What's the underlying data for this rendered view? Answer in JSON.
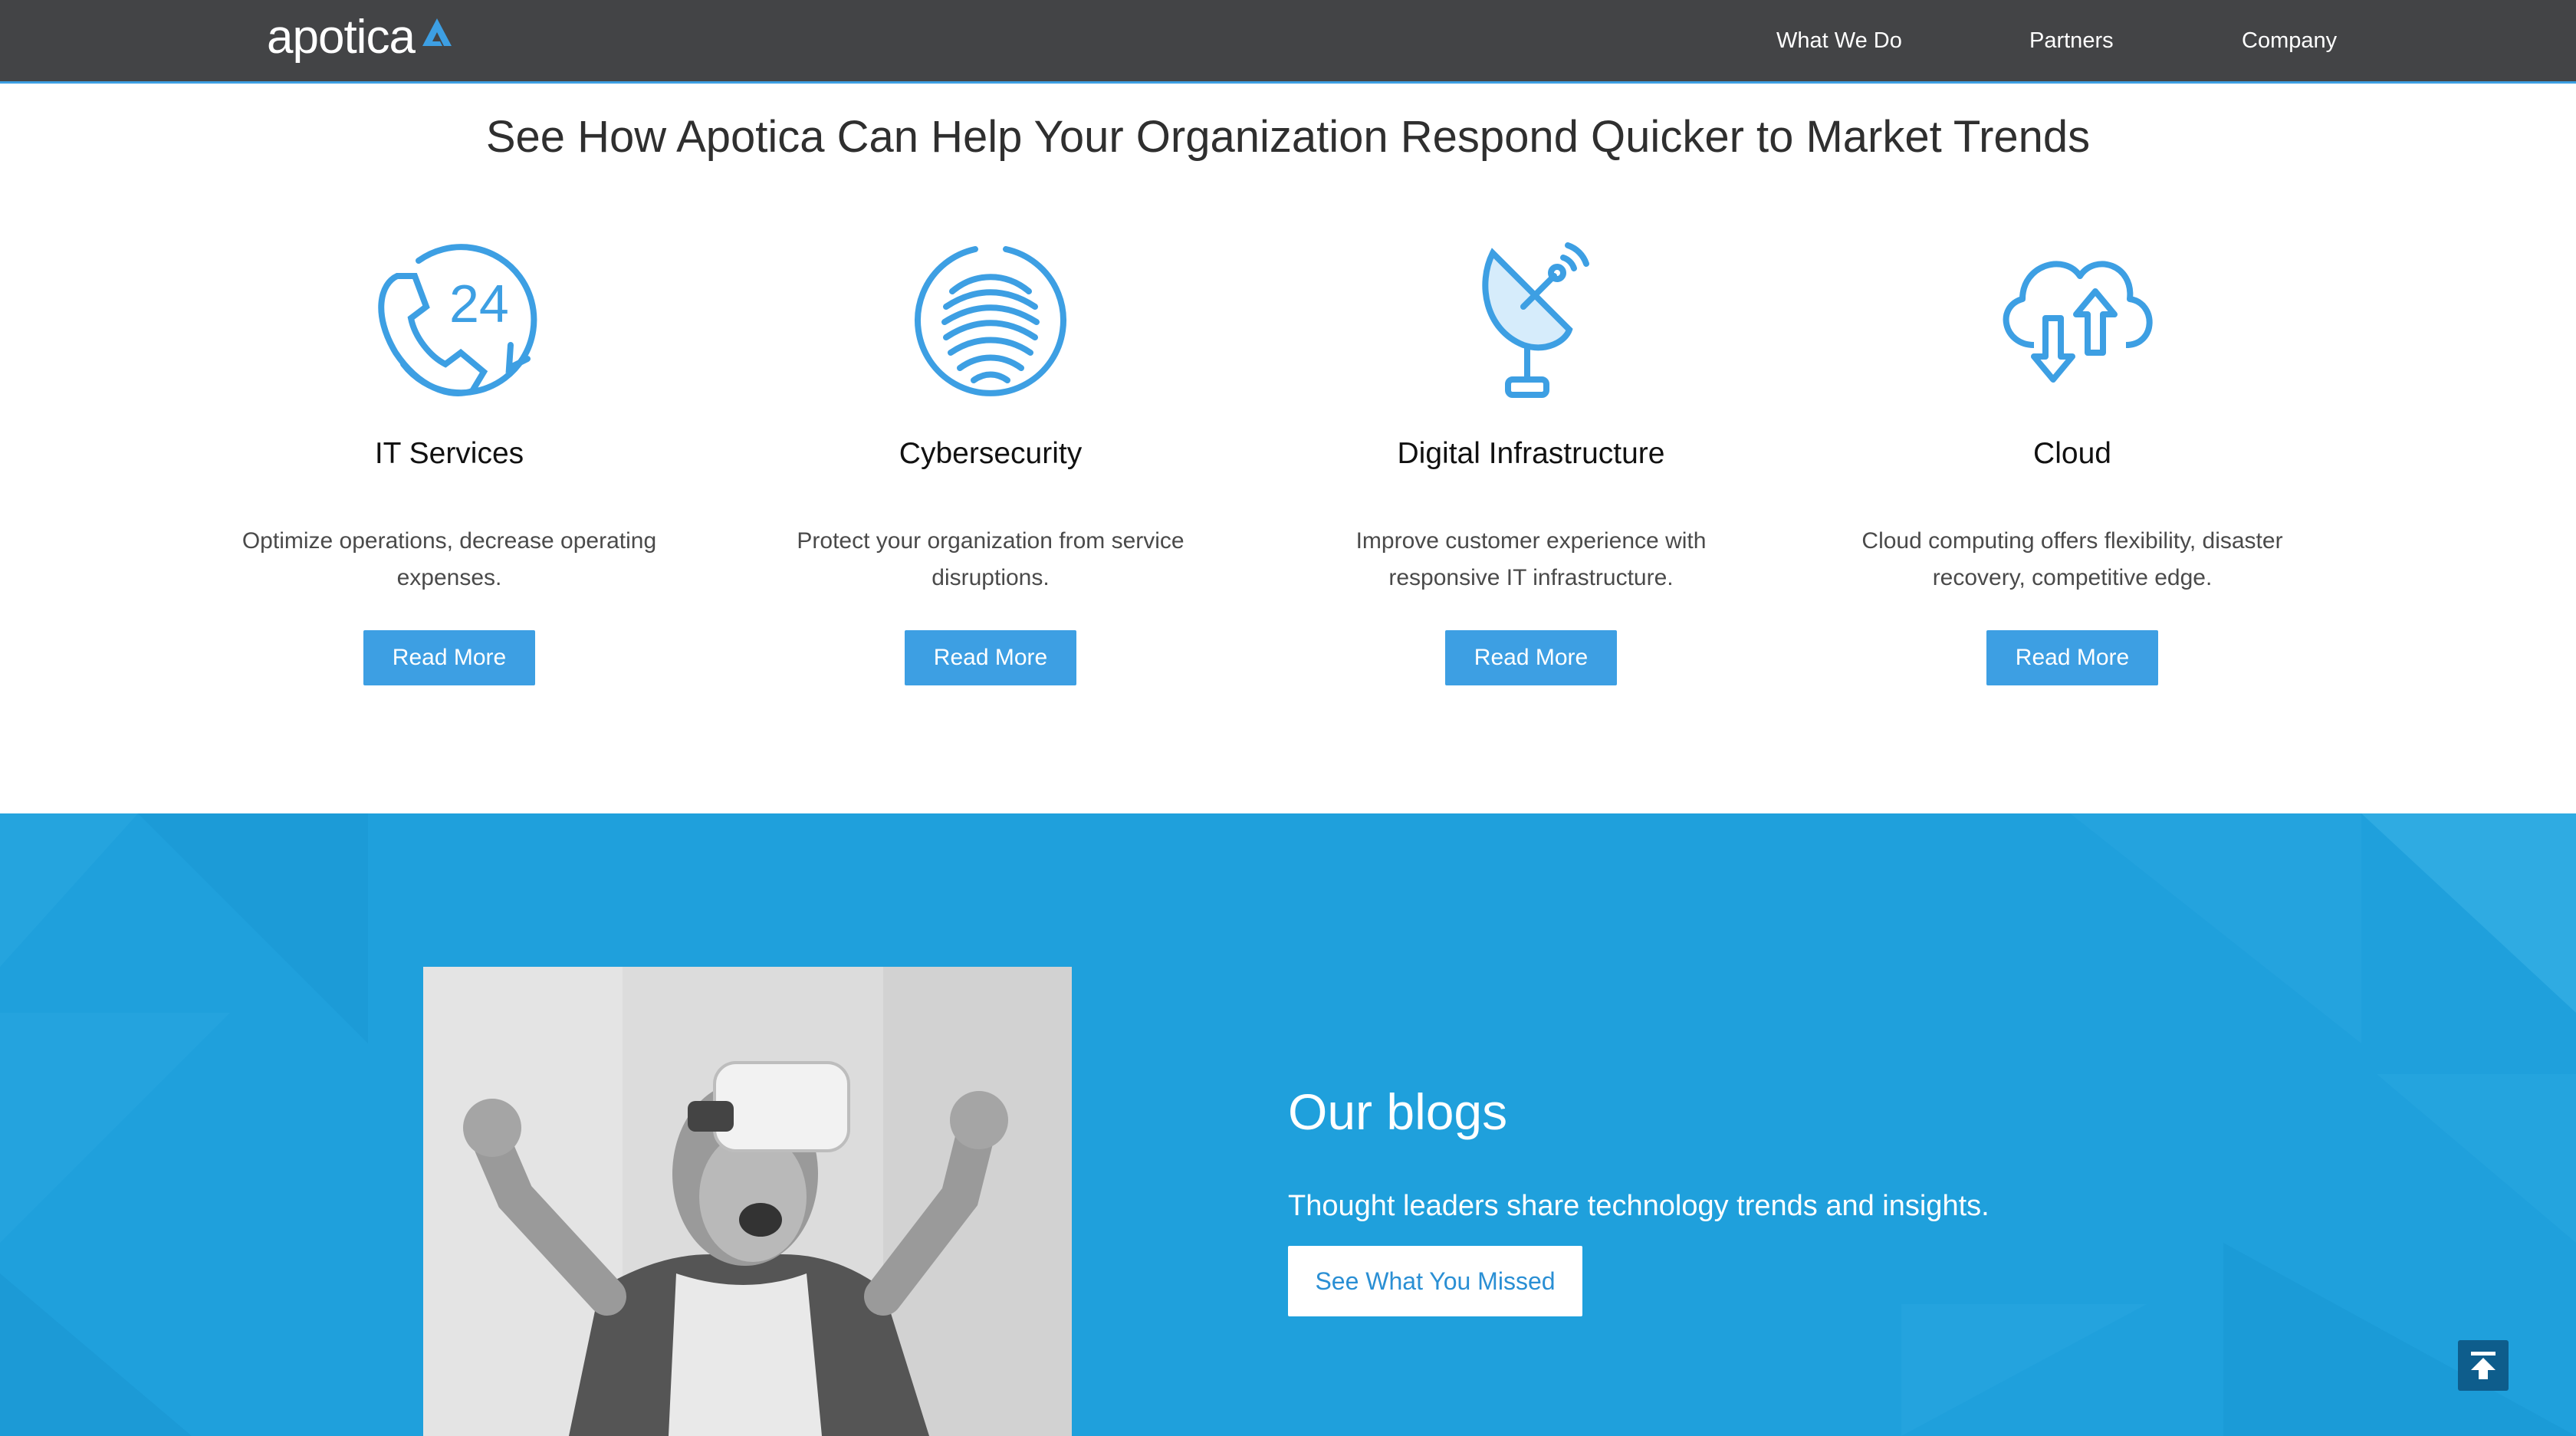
{
  "header": {
    "logo_text": "apotica",
    "nav": [
      "What We Do",
      "Partners",
      "Company"
    ]
  },
  "services": {
    "headline": "See How Apotica Can Help Your Organization Respond Quicker to Market Trends",
    "items": [
      {
        "icon": "phone-24-icon",
        "title": "IT Services",
        "desc": "Optimize operations, decrease operating expenses.",
        "button": "Read More"
      },
      {
        "icon": "fingerprint-icon",
        "title": "Cybersecurity",
        "desc": "Protect your organization from service disruptions.",
        "button": "Read More"
      },
      {
        "icon": "satellite-dish-icon",
        "title": "Digital Infrastructure",
        "desc": "Improve customer experience with responsive IT infrastructure.",
        "button": "Read More"
      },
      {
        "icon": "cloud-transfer-icon",
        "title": "Cloud",
        "desc": "Cloud computing offers flexibility, disaster recovery, competitive edge.",
        "button": "Read More"
      }
    ]
  },
  "blogs": {
    "title": "Our blogs",
    "subtitle": "Thought leaders share technology trends and insights.",
    "button": "See What You Missed"
  },
  "colors": {
    "header_bg": "#434446",
    "accent": "#3d9fe3",
    "band_bg": "#1fa0dc",
    "back_to_top": "#0e5d8c"
  },
  "icons": {
    "logo_mark": "apotica-a-logo-icon",
    "back_to_top": "arrow-up-bar-icon"
  }
}
